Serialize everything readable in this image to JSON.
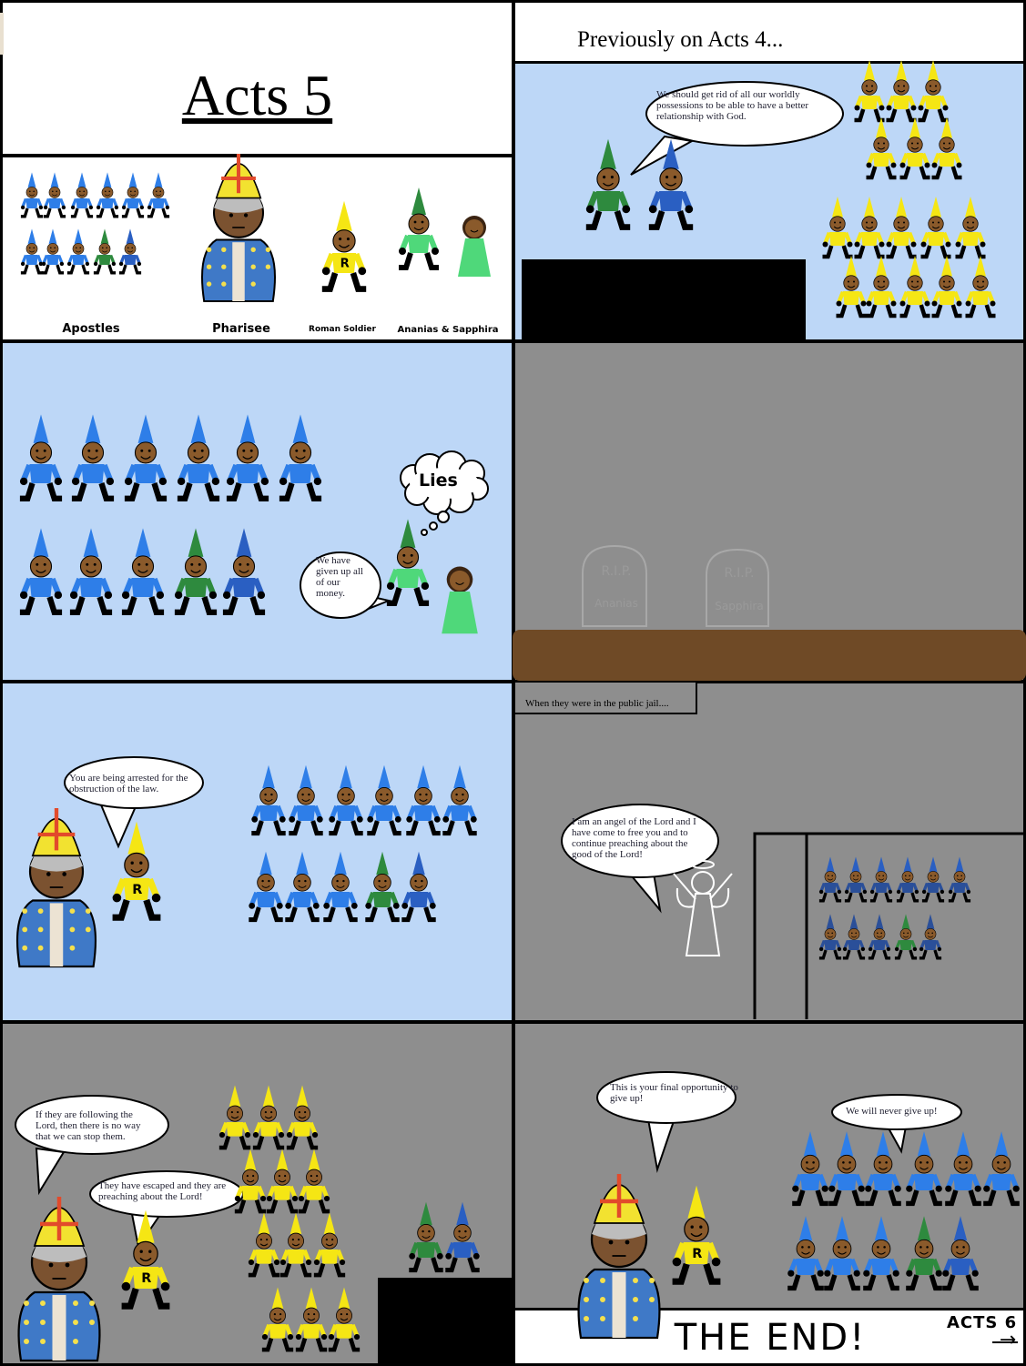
{
  "title": "Acts 5",
  "recap_caption": "Previously on Acts 4...",
  "cast": {
    "apostles": "Apostles",
    "pharisee": "Pharisee",
    "soldier": "Roman Soldier",
    "couple": "Ananias & Sapphira"
  },
  "scene1": {
    "speech": "We should get rid of all our worldly possessions to be able to have a better relationship with God."
  },
  "scene2": {
    "speech": "We have given up all of our money.",
    "thought": "Lies"
  },
  "scene3": {
    "tomb_left_rip": "R.I.P.",
    "tomb_left_name": "Ananias",
    "tomb_right_rip": "R.I.P.",
    "tomb_right_name": "Sapphira"
  },
  "scene4": {
    "speech": "You are being arrested for the obstruction of the law."
  },
  "scene5": {
    "caption": "When they were in the public jail....",
    "speech": "I am an angel of the Lord and I have come to free you and to continue preaching about the good of the Lord!"
  },
  "scene6": {
    "speech_pharisee": "If they are following the Lord, then there is no way that we can stop them.",
    "speech_soldier": "They have escaped and they are preaching about the Lord!"
  },
  "scene7": {
    "speech_pharisee": "This is your final opportunity to give up!",
    "speech_apostles": "We will never give up!"
  },
  "ending": {
    "text": "THE END!",
    "next_label": "ACTS 6",
    "next_arrow": "→"
  },
  "colors": {
    "sky": "#bdd7f7",
    "ground": "#8e8e8e",
    "apostle": "#2e7ee8",
    "leader": "#2a5fc2",
    "green": "#2e8a3e",
    "soldier": "#f5e614",
    "dirt": "#6f4a26",
    "ananias": "#4fd87a"
  }
}
